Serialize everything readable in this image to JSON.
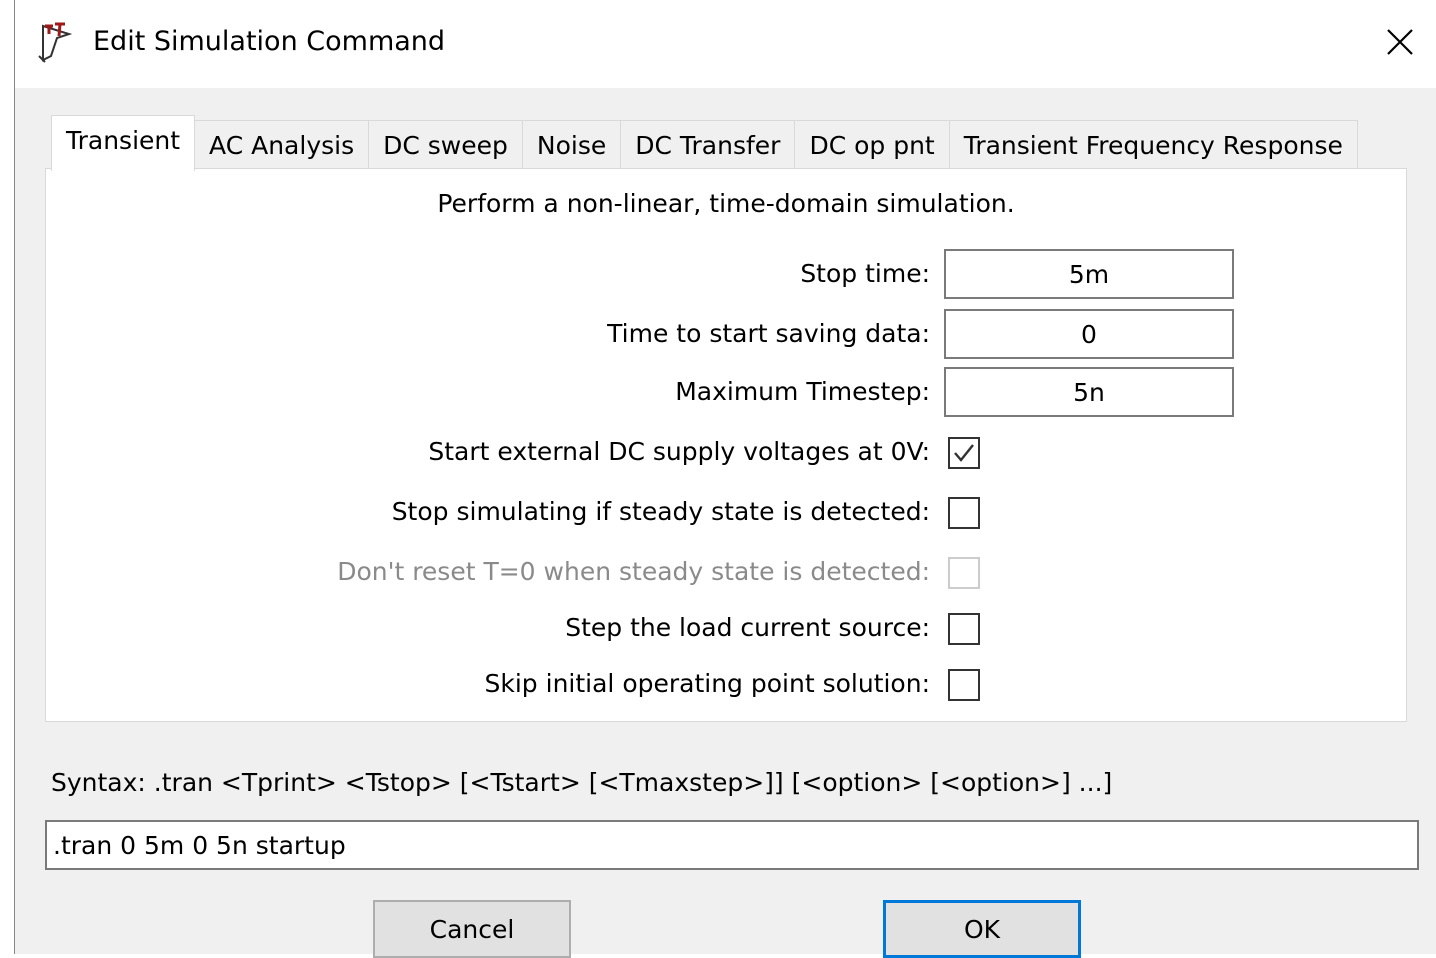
{
  "window": {
    "title": "Edit Simulation Command",
    "logo_icon": "ltspice-logo-icon",
    "close_icon": "close-icon"
  },
  "tabs": [
    {
      "label": "Transient",
      "active": true
    },
    {
      "label": "AC Analysis",
      "active": false
    },
    {
      "label": "DC sweep",
      "active": false
    },
    {
      "label": "Noise",
      "active": false
    },
    {
      "label": "DC Transfer",
      "active": false
    },
    {
      "label": "DC op pnt",
      "active": false
    },
    {
      "label": "Transient Frequency Response",
      "active": false
    }
  ],
  "transient": {
    "description": "Perform a non-linear, time-domain simulation.",
    "fields": [
      {
        "label": "Stop time:",
        "value": "5m"
      },
      {
        "label": "Time to start saving data:",
        "value": "0"
      },
      {
        "label": "Maximum Timestep:",
        "value": "5n"
      }
    ],
    "options": [
      {
        "label": "Start external DC supply voltages at 0V:",
        "checked": true,
        "disabled": false
      },
      {
        "label": "Stop simulating if steady state is detected:",
        "checked": false,
        "disabled": false
      },
      {
        "label": "Don't reset T=0 when steady state is detected:",
        "checked": false,
        "disabled": true
      },
      {
        "label": "Step the load current source:",
        "checked": false,
        "disabled": false
      },
      {
        "label": "Skip initial operating point solution:",
        "checked": false,
        "disabled": false
      }
    ]
  },
  "syntax": "Syntax:  .tran <Tprint> <Tstop> [<Tstart> [<Tmaxstep>]] [<option> [<option>] ...]",
  "command": ".tran 0 5m 0 5n startup",
  "buttons": {
    "cancel": "Cancel",
    "ok": "OK"
  },
  "colors": {
    "accent": "#0078d7",
    "logo_red": "#a01818",
    "disabled_text": "#8a8a8a"
  }
}
